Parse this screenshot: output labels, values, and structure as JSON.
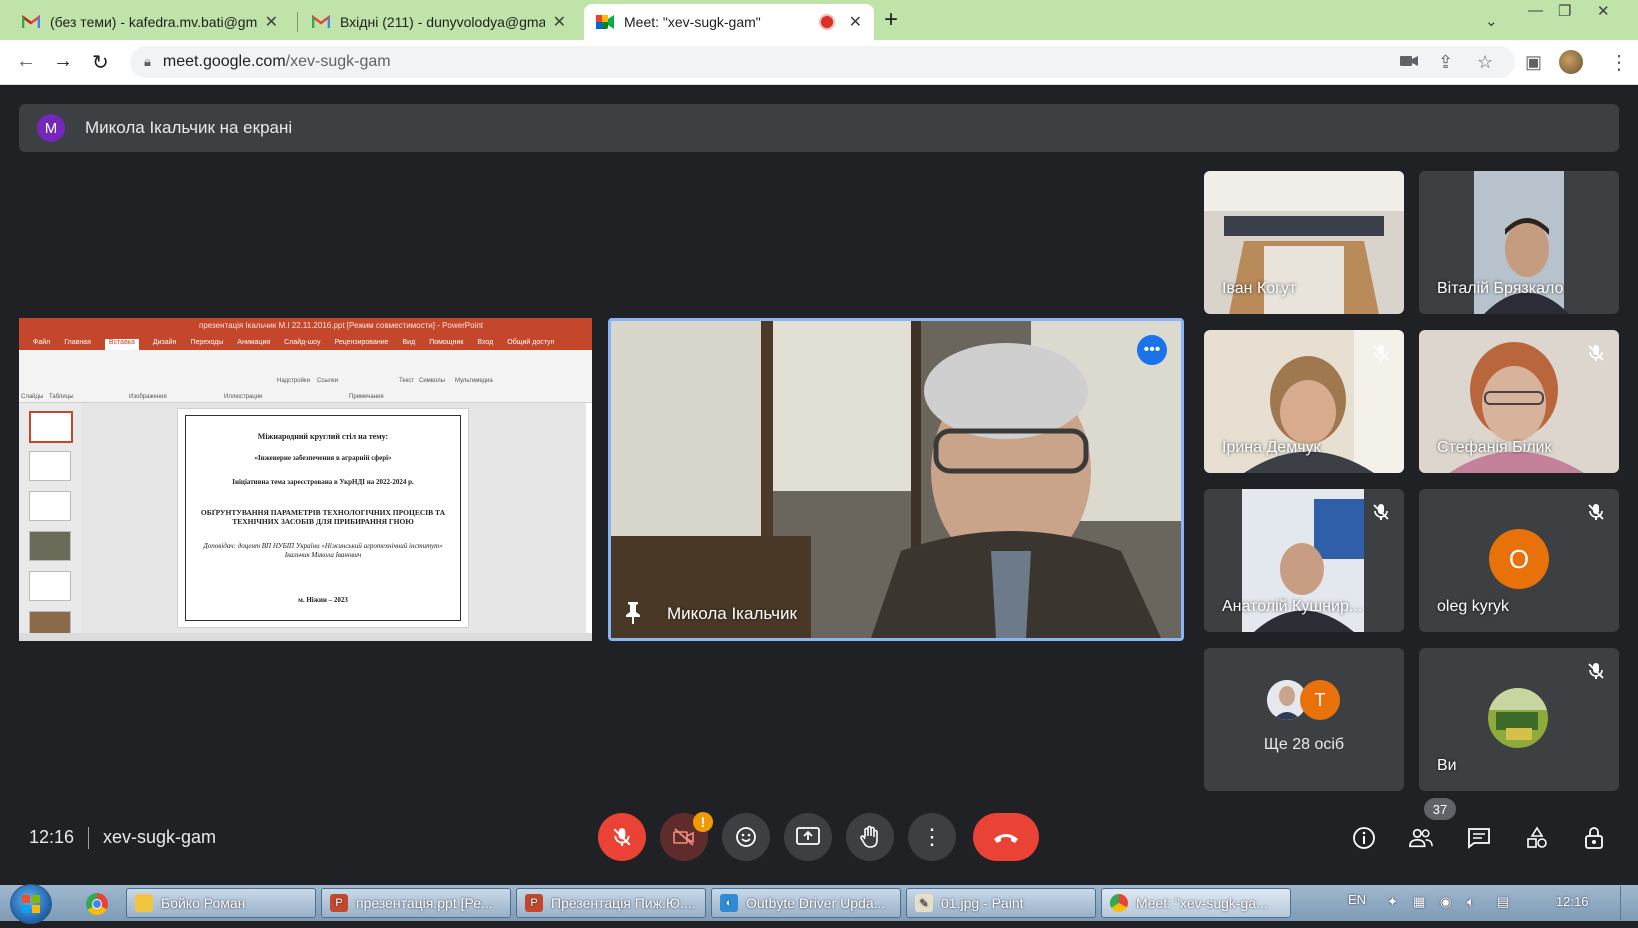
{
  "browser": {
    "tabs": [
      {
        "title": "(без теми) - kafedra.mv.bati@gm",
        "icon": "gmail-icon"
      },
      {
        "title": "Вхідні (211) - dunyvolodya@gma",
        "icon": "gmail-icon"
      },
      {
        "title": "Meet: \"xev-sugk-gam\"",
        "icon": "meet-icon",
        "recording": true
      }
    ],
    "url_host": "meet.google.com",
    "url_path": "/xev-sugk-gam"
  },
  "meet": {
    "presenter_banner": {
      "avatar_letter": "M",
      "text": "Микола Ікальчик на екрані"
    },
    "speaker_name": "Микола Ікальчик",
    "slide": {
      "app_title": "презентація Ікальчик М.І 22.11.2016.ppt [Режим совместимости] - PowerPoint",
      "ribbon_tabs": [
        "Файл",
        "Главная",
        "Вставка",
        "Дизайн",
        "Переходы",
        "Анимация",
        "Слайд-шоу",
        "Рецензирование",
        "Вид",
        "Помощник",
        "Вход",
        "Общий доступ"
      ],
      "ribbon_groups": [
        "Слайды",
        "Таблицы",
        "Изображения",
        "Иллюстрации",
        "Надстройки",
        "Ссылки",
        "Примечания",
        "Текст",
        "Символы",
        "Мультимедиа"
      ],
      "lines": [
        "Міжнародний круглий стіл на тему:",
        "«Інженерне забезпечення в аграрній сфері»",
        "Ініціативна тема зареєстрована в УкрНДІ на 2022-2024 р.",
        "ОБҐРУНТУВАННЯ ПАРАМЕТРІВ ТЕХНОЛОГІЧНИХ ПРОЦЕСІВ ТА ТЕХНІЧНИХ ЗАСОБІВ ДЛЯ ПРИБИРАННЯ ГНОЮ",
        "Доповідач: доцент ВП НУБІП України «Ніжинський агротехнічний інститут» Ікальчик Микола Іванович",
        "м. Ніжин – 2023"
      ]
    },
    "participants": [
      {
        "name": "Іван Когут",
        "muted": false,
        "kind": "video"
      },
      {
        "name": "Віталій Брязкало",
        "muted": false,
        "kind": "video"
      },
      {
        "name": "Ірина Демчук",
        "muted": true,
        "kind": "video"
      },
      {
        "name": "Стефанія Білик",
        "muted": true,
        "kind": "video"
      },
      {
        "name": "Анатолій Кушнир...",
        "muted": true,
        "kind": "video"
      },
      {
        "name": "oleg kyryk",
        "muted": true,
        "kind": "avatar",
        "avatar_letter": "O"
      },
      {
        "name": "Ще 28 осіб",
        "kind": "more",
        "avatar_letter": "T"
      },
      {
        "name": "Ви",
        "muted": true,
        "kind": "self"
      }
    ],
    "bottom": {
      "time": "12:16",
      "meeting_code": "xev-sugk-gam",
      "people_count": "37"
    }
  },
  "taskbar": {
    "items": [
      {
        "label": "Бойко Роман"
      },
      {
        "label": "презентація.ppt [Ре..."
      },
      {
        "label": "Презентація Пиж.Ю...."
      },
      {
        "label": "Outbyte Driver Upda..."
      },
      {
        "label": "01.jpg - Paint"
      },
      {
        "label": "Meet: \"xev-sugk-ga..."
      }
    ],
    "lang": "EN",
    "clock": "12:16"
  },
  "colors": {
    "meet_bg": "#202124",
    "accent_blue": "#1a73e8",
    "end_call_red": "#ea4335",
    "tabstrip": "#bfe3a8"
  }
}
